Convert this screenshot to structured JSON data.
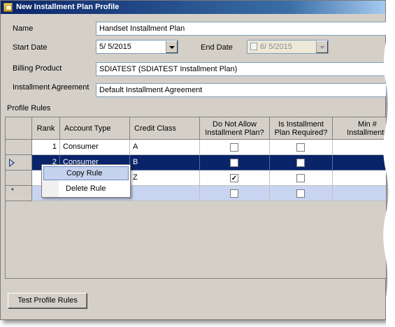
{
  "window": {
    "title": "New Installment Plan Profile",
    "icon": "profile-icon"
  },
  "form": {
    "name_label": "Name",
    "name_value": "Handset Installment Plan",
    "start_date_label": "Start Date",
    "start_date_value": "5/ 5/2015",
    "end_date_label": "End Date",
    "end_date_value": "6/ 5/2015",
    "billing_product_label": "Billing Product",
    "billing_product_value": "SDIATEST  (SDIATEST  Installment  Plan)",
    "installment_agreement_label": "Installment Agreement",
    "installment_agreement_value": "Default Installment Agreement"
  },
  "profile_rules": {
    "section_label": "Profile Rules",
    "columns": [
      "Rank",
      "Account Type",
      "Credit Class",
      "Do Not Allow\nInstallment Plan?",
      "Is Installment\nPlan Required?",
      "Min #\nInstallments"
    ],
    "rows": [
      {
        "rank": "1",
        "account_type": "Consumer",
        "credit_class": "A",
        "do_not_allow": false,
        "required": false
      },
      {
        "rank": "2",
        "account_type": "Consumer",
        "credit_class": "B",
        "do_not_allow": false,
        "required": false
      },
      {
        "rank": "",
        "account_type": "",
        "credit_class": "Z",
        "do_not_allow": true,
        "required": false
      }
    ]
  },
  "context_menu": {
    "items": [
      "Copy Rule",
      "Delete Rule"
    ]
  },
  "buttons": {
    "test_profile_rules": "Test Profile Rules"
  },
  "colors": {
    "selection": "#0a246a",
    "new_row": "#c8d4f0",
    "menu_hover": "#c6d3ee"
  }
}
